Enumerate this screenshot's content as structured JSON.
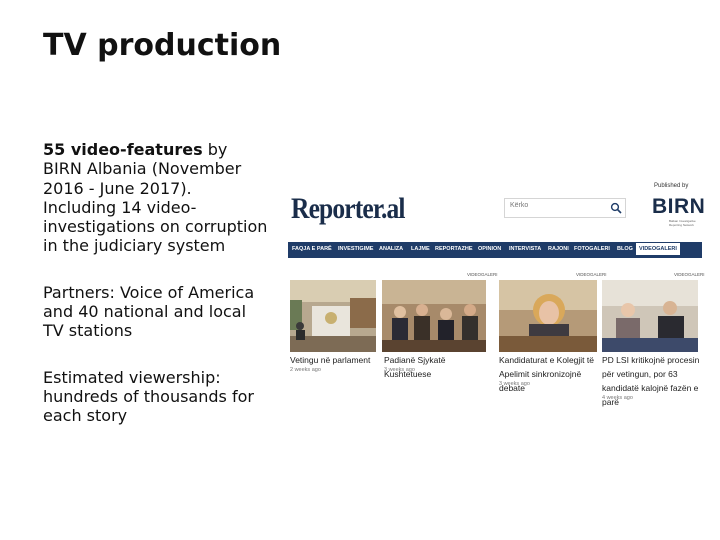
{
  "slide": {
    "title": "TV production",
    "paragraphs": [
      {
        "bold": "55 video-features",
        "text": " by BIRN Albania (November 2016 - June 2017). Including 14 video-investigations on corruption in the judiciary system"
      },
      {
        "bold": "",
        "text": "Partners: Voice of America and 40 national and local TV stations"
      },
      {
        "bold": "",
        "text": "Estimated viewership: hundreds of thousands for each story"
      }
    ]
  },
  "site": {
    "logo": "Reporter.al",
    "search_placeholder": "Kërko",
    "published_by": "Published by",
    "birn": "BIRN",
    "birn_sub": "Balkan Investigative Reporting Network",
    "nav": [
      "FAQJA E PARË",
      "INVESTIGIME",
      "ANALIZA",
      "LAJME",
      "REPORTAZHE",
      "OPINION",
      "INTERVISTA",
      "RAJONI",
      "FOTOGALERI",
      "BLOG",
      "VIDEOGALERI"
    ],
    "nav_active_index": 10,
    "cards": [
      {
        "tag": "",
        "title": "Vetingu në parlament",
        "time": "2 weeks ago"
      },
      {
        "tag": "VIDEOGALERI",
        "title": "Padianë Sjykatë Kushtetuese",
        "time": "3 weeks ago"
      },
      {
        "tag": "VIDEOGALERI",
        "title": "Kandidaturat e Kolegjit të Apelimit sinkronizojnë debate",
        "time": "3 weeks ago"
      },
      {
        "tag": "VIDEOGALERI",
        "title": "PD LSI kritikojnë procesin për vetingun, por 63 kandidatë kalojnë fazën e parë",
        "time": "4 weeks ago"
      }
    ],
    "colors": {
      "nav_bg": "#1f3c68",
      "logo": "#1a2d4a"
    }
  }
}
